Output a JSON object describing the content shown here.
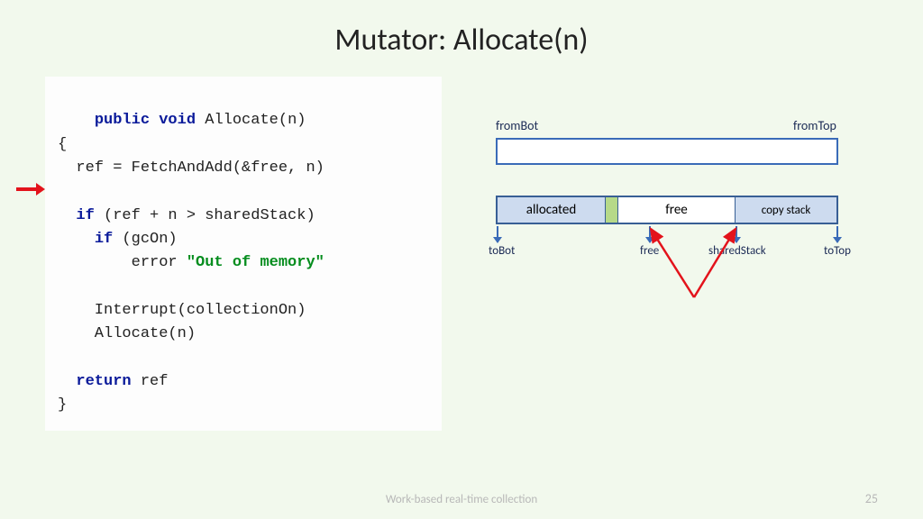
{
  "title": "Mutator: Allocate(n)",
  "code": {
    "l1a": "public",
    "l1b": "void",
    "l1c": " Allocate(n)",
    "l2": "{",
    "l3": "  ref = FetchAndAdd(&free, n)",
    "l5a": "if",
    "l5b": " (ref + n > sharedStack)",
    "l6a": "if",
    "l6b": " (gcOn)",
    "l7a": "        error ",
    "l7b": "\"Out of memory\"",
    "l9": "    Interrupt(collectionOn)",
    "l10": "    Allocate(n)",
    "l12a": "return",
    "l12b": " ref",
    "l13": "}"
  },
  "diagram": {
    "fromBot": "fromBot",
    "fromTop": "fromTop",
    "allocated": "allocated",
    "free_seg": "free",
    "copy_stack": "copy stack",
    "toBot": "toBot",
    "free_ptr": "free",
    "sharedStack": "sharedStack",
    "toTop": "toTop"
  },
  "footer": "Work-based real-time collection",
  "page": "25"
}
